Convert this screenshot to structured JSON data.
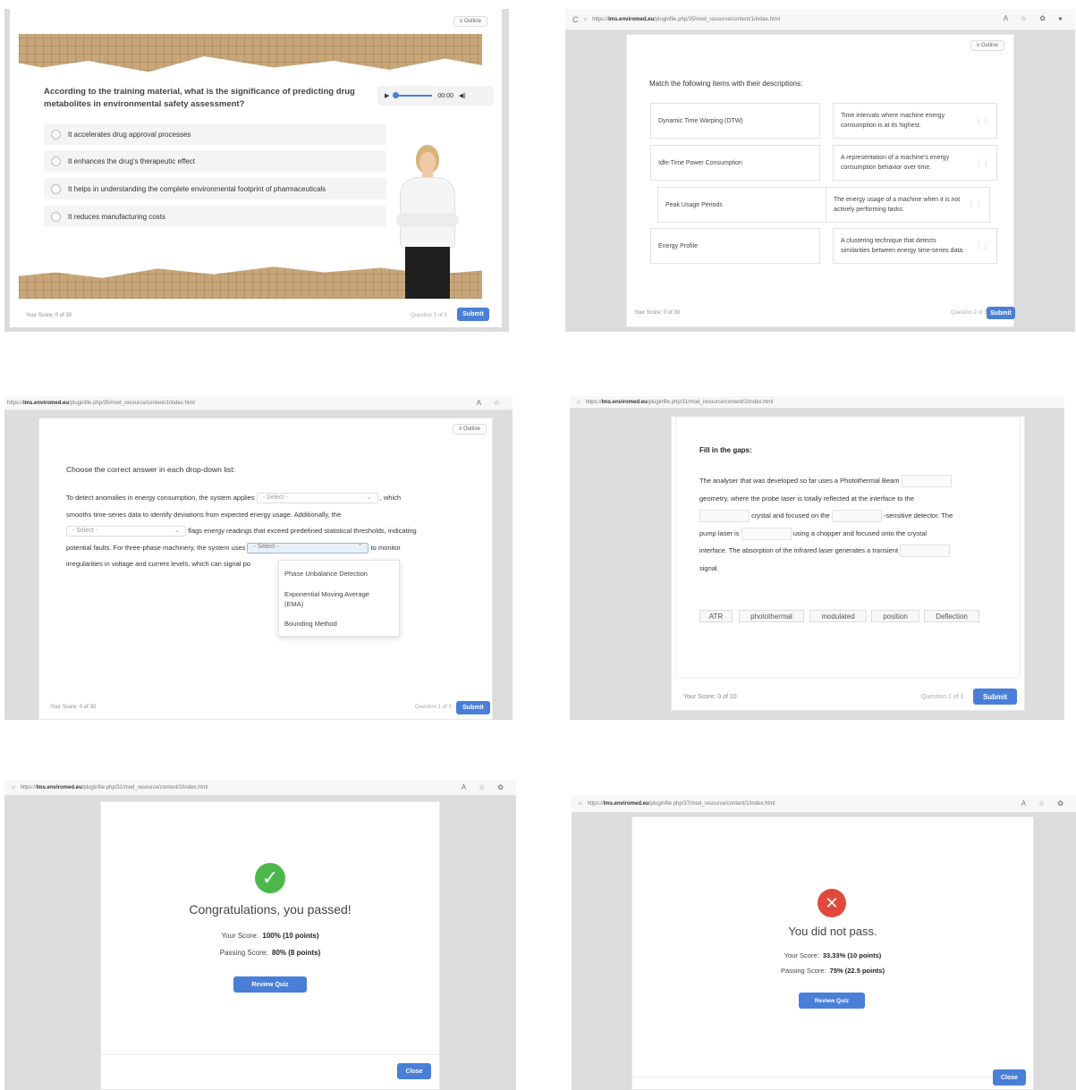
{
  "p1": {
    "outline_label": "Outline",
    "question": "According to the training material, what is the significance of predicting drug metabolites in environmental safety assessment?",
    "audio_time": "00:00",
    "options": [
      "It accelerates drug approval processes",
      "It enhances the drug's therapeutic effect",
      "It helps in understanding the complete environmental footprint of pharmaceuticals",
      "It reduces manufacturing costs"
    ],
    "score": "Your Score: 0 of 30",
    "question_count": "Question 3 of 3",
    "submit": "Submit"
  },
  "p2": {
    "url_prefix": "https://",
    "url_host": "lms.enviromed.eu",
    "url_path": "/pluginfile.php/35/mod_resource/content/1/index.html",
    "outline_label": "Outline",
    "instruction": "Match the following items with their descriptions:",
    "left_items": [
      "Dynamic Time Warping (DTW)",
      "Idle-Time Power Consumption",
      "Peak Usage Periods",
      "Energy Profile"
    ],
    "right_items": [
      "Time intervals where machine energy consumption is at its highest.",
      "A representation of a machine's energy consumption behavior over time.",
      "The energy usage of a machine when it is not actively performing tasks.",
      "A clustering technique that detects similarities between energy time-series data."
    ],
    "score": "Your Score: 0 of 30",
    "question_count": "Question 2 of 3",
    "submit": "Submit"
  },
  "p3": {
    "url_prefix": "https://",
    "url_host": "lms.enviromed.eu",
    "url_path": "/pluginfile.php/35/mod_resource/content/1/index.html",
    "outline_label": "Outline",
    "instruction": "Choose the correct answer in each drop-down list:",
    "t1": "To detect anomalies in energy consumption, the system applies",
    "t2": ", which",
    "t3": "smooths time-series data to identify deviations from expected energy usage. Additionally, the",
    "t4": "flags energy readings that exceed predefined statistical thresholds, indicating",
    "t5": "potential faults. For three-phase machinery, the system uses",
    "t6": "to monitor",
    "t7": "irregularities in voltage and current levels, which can signal po",
    "select_placeholder": "- Select -",
    "dropdown_options": [
      "Phase Unbalance Detection",
      "Exponential Moving Average (EMA)",
      "Bounding Method"
    ],
    "score": "Your Score: 0 of 30",
    "question_count": "Question 1 of 3",
    "submit": "Submit"
  },
  "p4": {
    "url_prefix": "https://",
    "url_host": "lms.enviromed.eu",
    "url_path": "/pluginfile.php/31/mod_resource/content/2/index.html",
    "title": "Fill in the gaps:",
    "s1": "The analyser that was developed so far uses a Photothermal Beam",
    "s2": "geometry, where the probe laser is totally reflected at the interface to the",
    "s3": "crystal and focused on the",
    "s4": "-sensitive detector. The",
    "s5": "pump laser is",
    "s6": "using a chopper and focused onto the crystal",
    "s7": "interface. The absorption of the infrared laser generates a transient",
    "s8": "signal.",
    "chips": [
      "ATR",
      "photothermal",
      "modulated",
      "position",
      "Deflection"
    ],
    "score": "Your Score: 0 of 10",
    "question_count": "Question 1 of 1",
    "submit": "Submit"
  },
  "p5": {
    "url_prefix": "https://",
    "url_host": "lms.enviromed.eu",
    "url_path": "/pluginfile.php/31/mod_resource/content/2/index.html",
    "title": "Congratulations, you passed!",
    "your_score_label": "Your Score:",
    "your_score_value": "100% (10 points)",
    "passing_label": "Passing Score:",
    "passing_value": "80% (8 points)",
    "review": "Review Quiz",
    "close": "Close",
    "accent": "#4cb84c"
  },
  "p6": {
    "url_prefix": "https://",
    "url_host": "lms.enviromed.eu",
    "url_path": "/pluginfile.php/37/mod_resource/content/1/index.html",
    "title": "You did not pass.",
    "your_score_label": "Your Score:",
    "your_score_value": "33.33% (10 points)",
    "passing_label": "Passing Score:",
    "passing_value": "75% (22.5 points)",
    "review": "Review Quiz",
    "close": "Close",
    "accent": "#e04a3c"
  }
}
